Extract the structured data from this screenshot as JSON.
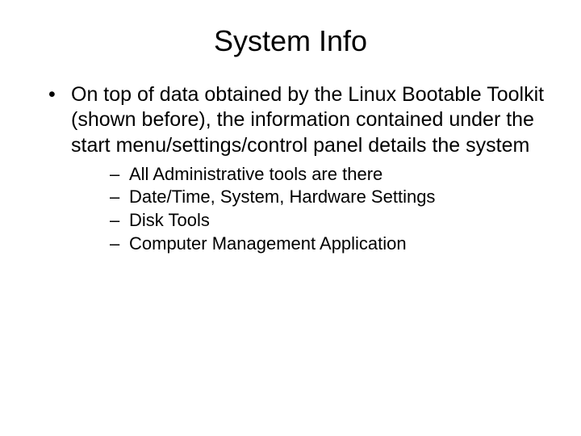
{
  "title": "System Info",
  "bullet": {
    "text": "On top of data obtained by the Linux Bootable Toolkit (shown before), the information contained under the start menu/settings/control panel details the system",
    "subitems": [
      "All Administrative tools are there",
      "Date/Time, System, Hardware Settings",
      "Disk Tools",
      "Computer Management Application"
    ]
  }
}
